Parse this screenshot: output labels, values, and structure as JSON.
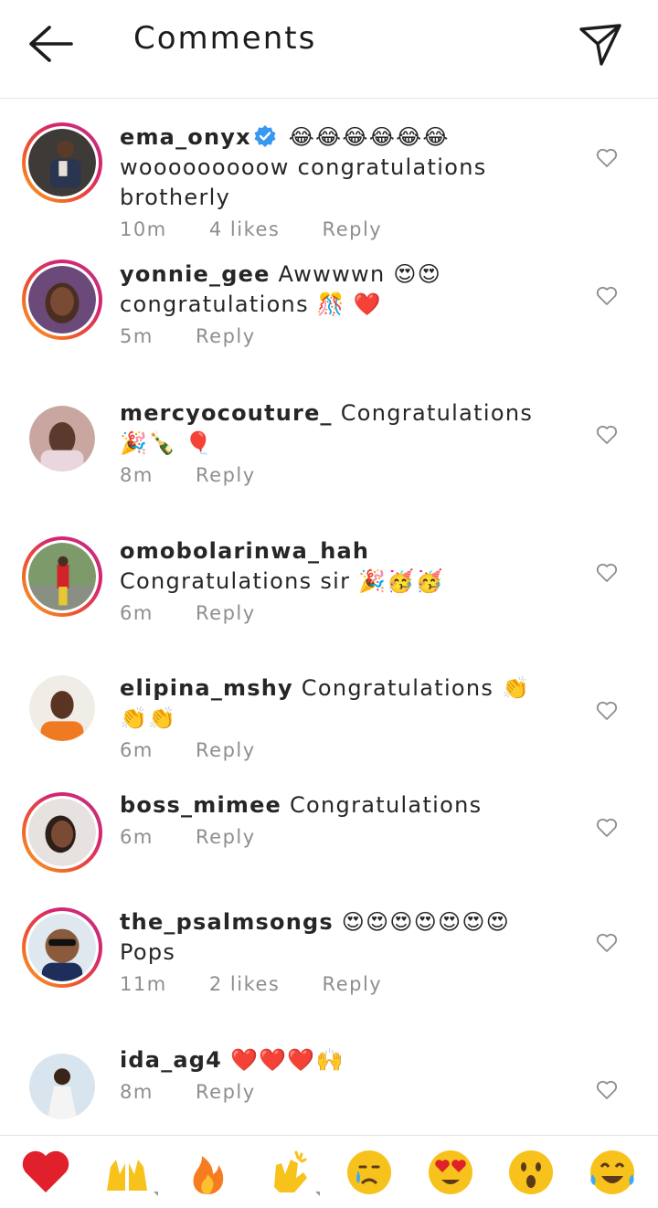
{
  "header": {
    "title": "Comments"
  },
  "comments": [
    {
      "username": "ema_onyx",
      "verified": true,
      "text": "😂😂😂😂😂😂 wooooooooow congratulations brotherly",
      "time": "10m",
      "likes": "4 likes",
      "reply": "Reply",
      "ring": true
    },
    {
      "username": "yonnie_gee",
      "text": "Awwwwn 😍😍 congratulations 🎊 ❤️",
      "time": "5m",
      "reply": "Reply",
      "ring": true
    },
    {
      "username": "mercyocouture_",
      "text": "Congratulations 🎉🍾 🎈",
      "time": "8m",
      "reply": "Reply",
      "ring": false
    },
    {
      "username": "omobolarinwa_hah",
      "text": "Congratulations sir 🎉🥳🥳",
      "time": "6m",
      "reply": "Reply",
      "ring": true
    },
    {
      "username": "elipina_mshy",
      "text": "Congratulations 👏👏👏",
      "time": "6m",
      "reply": "Reply",
      "ring": false
    },
    {
      "username": "boss_mimee",
      "text": "Congratulations",
      "time": "6m",
      "reply": "Reply",
      "ring": true
    },
    {
      "username": "the_psalmsongs",
      "text": "😍😍😍😍😍😍😍 Pops",
      "time": "11m",
      "likes": "2 likes",
      "reply": "Reply",
      "ring": true
    },
    {
      "username": "ida_ag4",
      "text": "❤️❤️❤️🙌",
      "time": "8m",
      "reply": "Reply",
      "ring": false
    }
  ],
  "quick_reactions": [
    "red-heart",
    "raising-hands",
    "fire",
    "clapping-hands",
    "crying-face",
    "heart-eyes",
    "surprised-face",
    "tears-of-joy"
  ],
  "colors": {
    "accent_ring_start": "#f9a825",
    "accent_ring_end": "#c13584",
    "verified_blue": "#3897f0",
    "meta_gray": "#8e8e8e"
  }
}
